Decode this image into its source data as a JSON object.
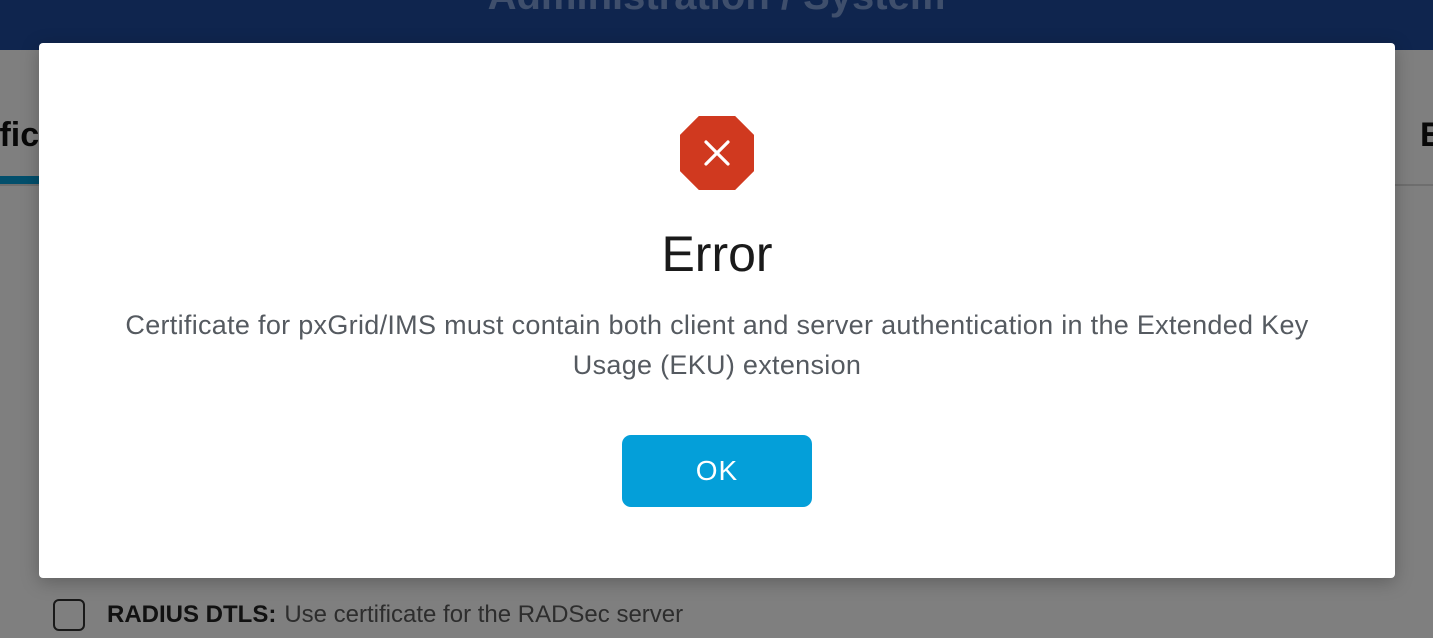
{
  "background": {
    "header_title": "Administration / System",
    "tab_left_fragment": "ific",
    "tab_right_fragment": "E",
    "option": {
      "label": "RADIUS DTLS:",
      "description": "Use certificate for the RADSec server",
      "checked": false
    }
  },
  "dialog": {
    "icon": "error-x-octagon-icon",
    "icon_color": "#d0391f",
    "title": "Error",
    "message": "Certificate for pxGrid/IMS must contain both client and server authentication in the Extended Key Usage (EKU) extension",
    "ok_label": "OK",
    "ok_color": "#049fd9"
  },
  "colors": {
    "header": "#1e4a9c",
    "accent": "#049fd9",
    "overlay": "rgba(0,0,0,0.5)"
  }
}
